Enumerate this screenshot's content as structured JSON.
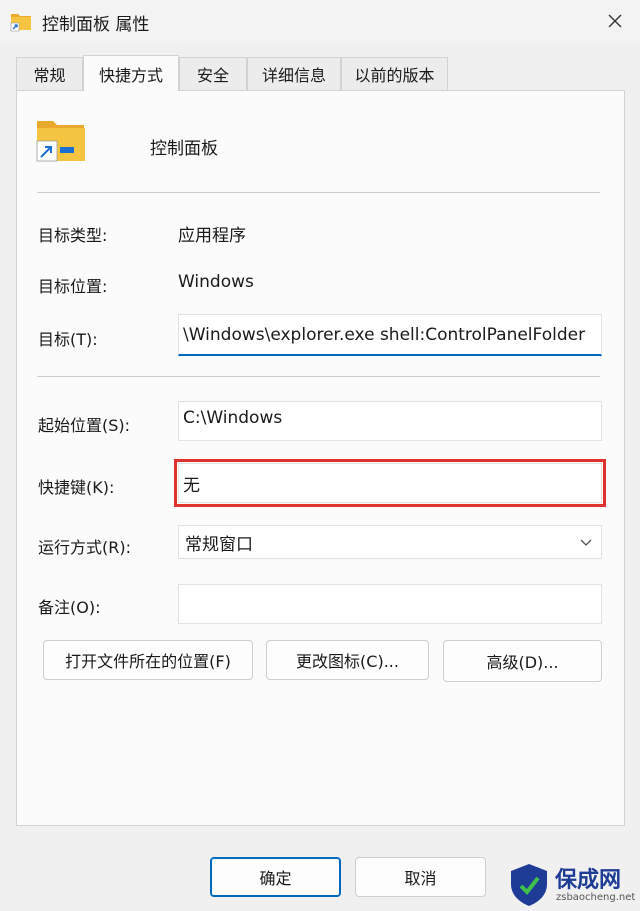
{
  "window": {
    "title": "控制面板 属性"
  },
  "tabs": [
    {
      "label": "常规"
    },
    {
      "label": "快捷方式"
    },
    {
      "label": "安全"
    },
    {
      "label": "详细信息"
    },
    {
      "label": "以前的版本"
    }
  ],
  "active_tab": "快捷方式",
  "shortcut": {
    "name": "控制面板"
  },
  "fields": {
    "target_type_label": "目标类型:",
    "target_type_value": "应用程序",
    "target_location_label": "目标位置:",
    "target_location_value": "Windows",
    "target_label": "目标(T):",
    "target_value": "\\Windows\\explorer.exe shell:ControlPanelFolder",
    "start_in_label": "起始位置(S):",
    "start_in_value": "C:\\Windows",
    "hotkey_label": "快捷键(K):",
    "hotkey_value": "无",
    "run_label": "运行方式(R):",
    "run_value": "常规窗口",
    "comment_label": "备注(O):",
    "comment_value": ""
  },
  "buttons": {
    "open_location": "打开文件所在的位置(F)",
    "change_icon": "更改图标(C)...",
    "advanced": "高级(D)...",
    "ok": "确定",
    "cancel": "取消"
  },
  "watermark": {
    "text": "保成网",
    "sub": "zsbaocheng.net"
  },
  "colors": {
    "accent": "#0067c0",
    "highlight": "#e0322e",
    "folder": "#f5c542"
  }
}
